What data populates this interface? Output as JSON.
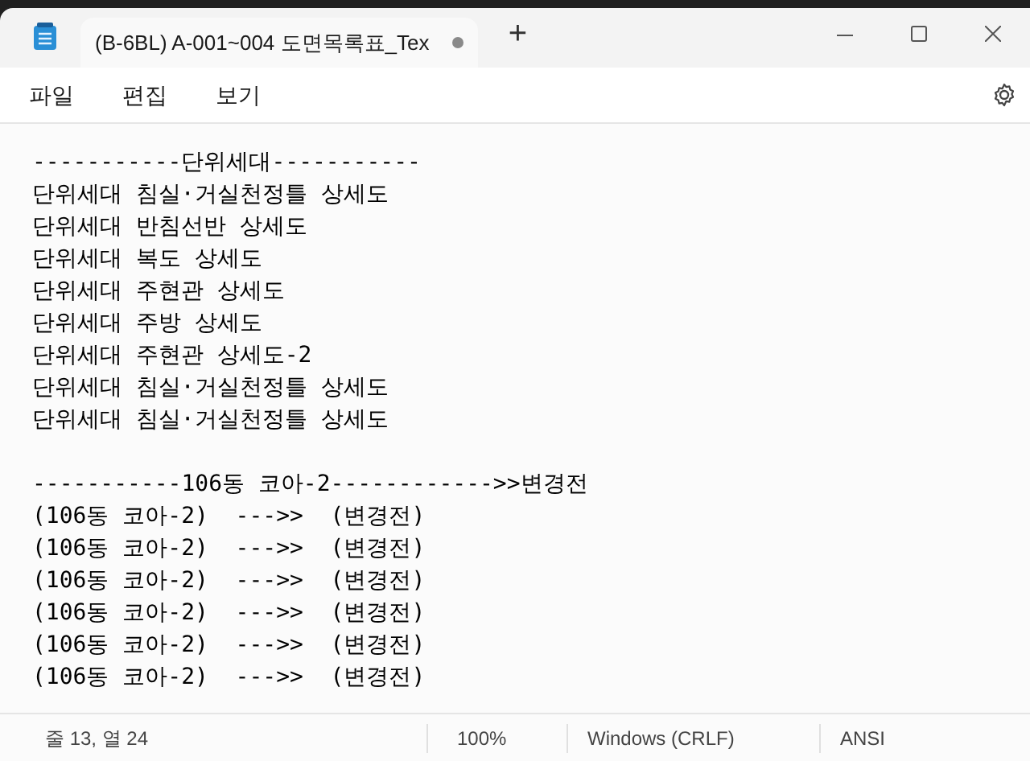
{
  "tabs": [
    {
      "title": "(B-6BL) A-001~004 도면목록표_Tex",
      "selected": true,
      "modified": true
    }
  ],
  "new_tab": "+",
  "menu": [
    "파일",
    "편집",
    "보기"
  ],
  "editor": {
    "sections": [
      {
        "lines": [
          "-----------단위세대-----------",
          "단위세대 침실·거실천정틀 상세도",
          "단위세대 반침선반 상세도",
          "단위세대 복도 상세도",
          "단위세대 주현관 상세도",
          "단위세대 주방 상세도",
          "단위세대 주현관 상세도-2",
          "단위세대 침실·거실천정틀 상세도",
          "단위세대 침실·거실천정틀 상세도"
        ]
      },
      {
        "lines": [
          "-----------106동 코아-2------------>>변경전",
          "(106동 코아-2)  --->>  (변경전)",
          "(106동 코아-2)  --->>  (변경전)",
          "(106동 코아-2)  --->>  (변경전)",
          "(106동 코아-2)  --->>  (변경전)",
          "(106동 코아-2)  --->>  (변경전)",
          "(106동 코아-2)  --->>  (변경전)"
        ]
      }
    ]
  },
  "status_bar": {
    "position": "줄 13, 열 24",
    "zoom": "100%",
    "line_ending": "Windows (CRLF)",
    "encoding": "ANSI"
  }
}
